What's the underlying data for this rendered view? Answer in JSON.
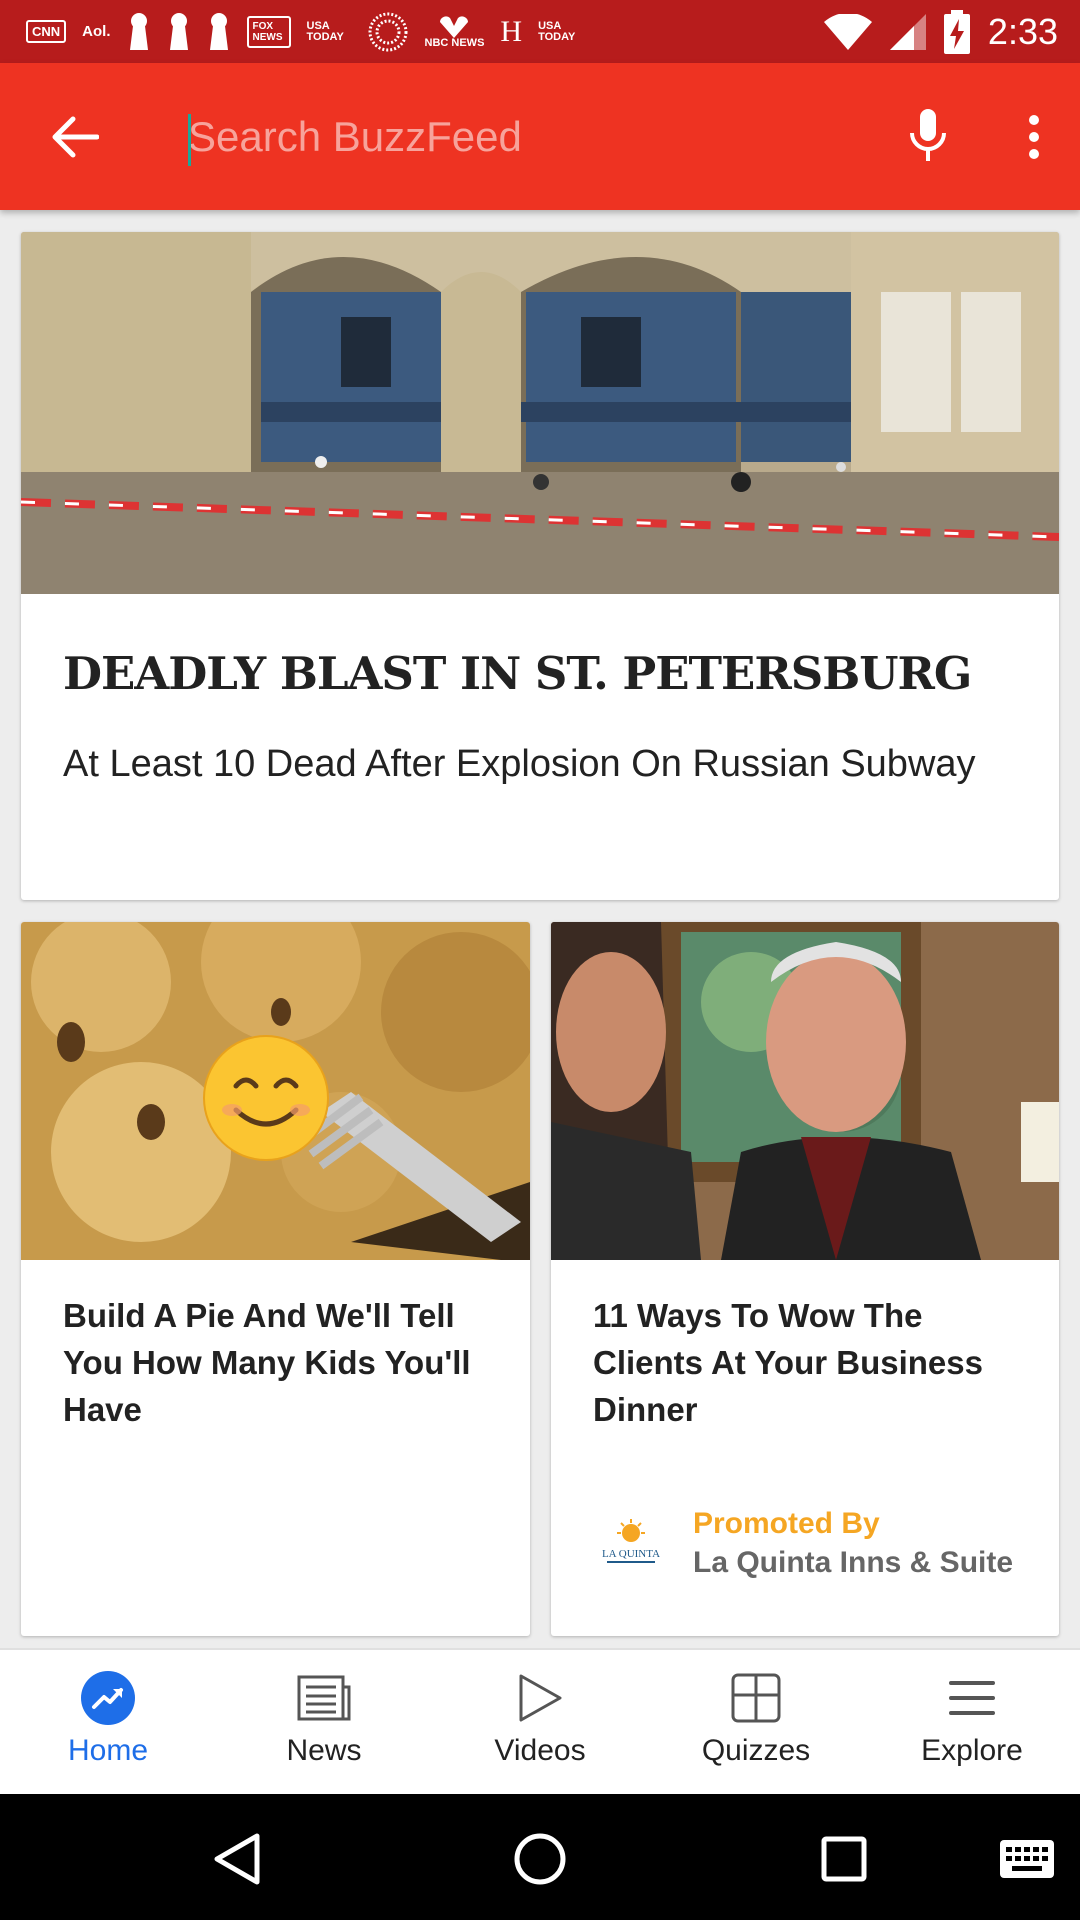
{
  "status_bar": {
    "notifications": [
      "CNN",
      "Aol.",
      "FOX NEWS",
      "USA TODAY",
      "NBC NEWS",
      "H",
      "USA TODAY"
    ],
    "time": "2:33"
  },
  "app_bar": {
    "search_placeholder": "Search BuzzFeed"
  },
  "feed": {
    "hero": {
      "headline": "DEADLY BLAST IN ST. PETERSBURG",
      "subhead": "At Least 10 Dead After Explosion On Russian Subway"
    },
    "tiles": [
      {
        "title": "Build A Pie And We'll Tell You How Many Kids You'll Have"
      },
      {
        "title": "11 Ways To Wow The Clients At Your Business Dinner",
        "promo_label": "Promoted By",
        "promo_name": "La Quinta Inns & Suites",
        "promo_logo_text": "LA QUINTA"
      }
    ]
  },
  "tab_bar": {
    "tabs": [
      {
        "label": "Home",
        "icon": "trending-icon",
        "active": true
      },
      {
        "label": "News",
        "icon": "newspaper-icon"
      },
      {
        "label": "Videos",
        "icon": "play-icon"
      },
      {
        "label": "Quizzes",
        "icon": "grid-icon"
      },
      {
        "label": "Explore",
        "icon": "menu-icon"
      }
    ],
    "active_color": "#1e6ee8"
  },
  "colors": {
    "brand": "#ee3322",
    "status_bar": "#b71c1c",
    "promo": "#f5a623"
  }
}
